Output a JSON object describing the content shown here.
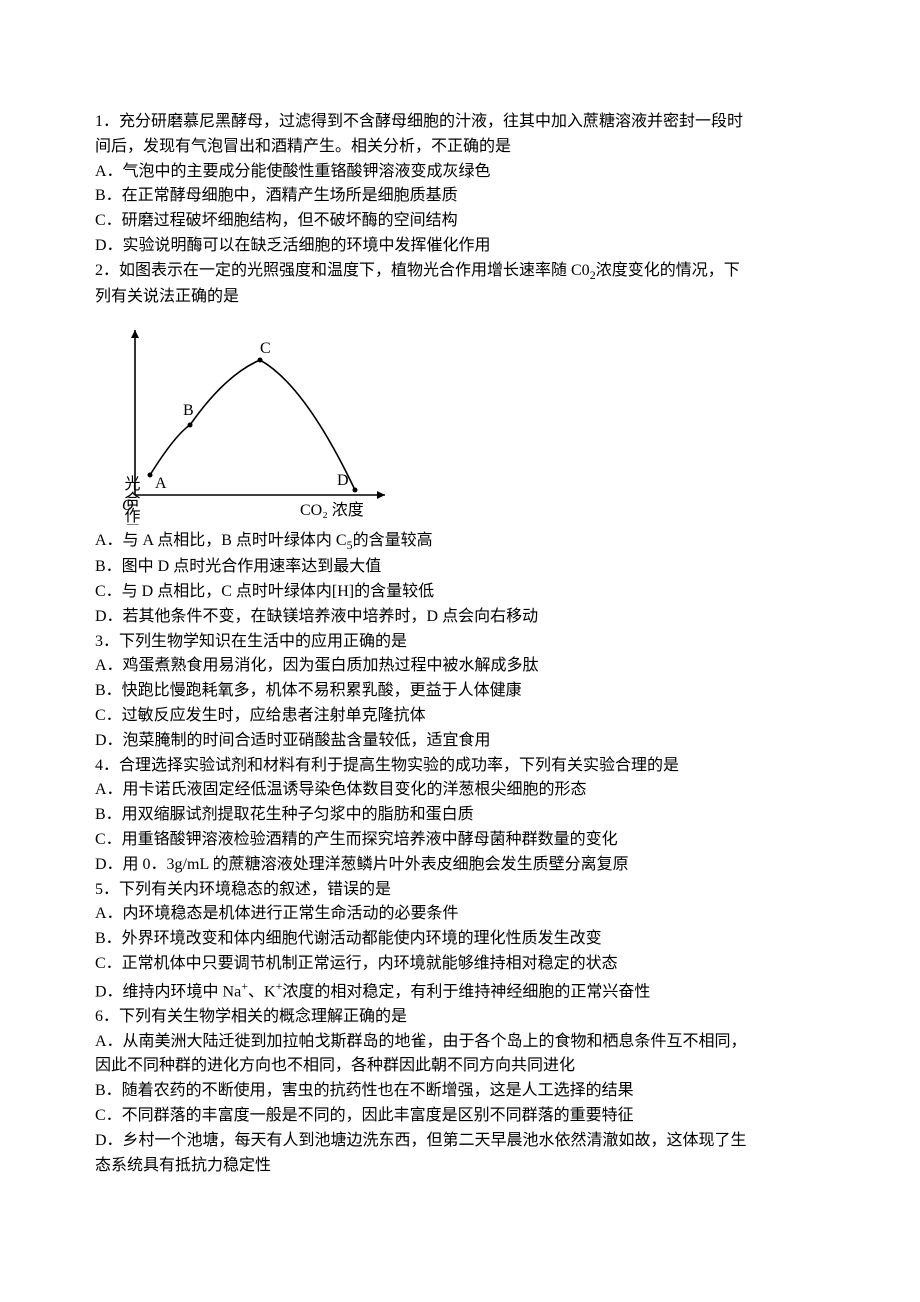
{
  "q1": {
    "stem_l1": "1．充分研磨慕尼黑酵母，过滤得到不含酵母细胞的汁液，往其中加入蔗糖溶液并密封一段时",
    "stem_l2": "间后，发现有气泡冒出和酒精产生。相关分析，不正确的是",
    "A": "A．气泡中的主要成分能使酸性重铬酸钾溶液变成灰绿色",
    "B": "B．在正常酵母细胞中，酒精产生场所是细胞质基质",
    "C": "C．研磨过程破坏细胞结构，但不破坏酶的空间结构",
    "D": "D．实验说明酶可以在缺乏活细胞的环境中发挥催化作用"
  },
  "q2": {
    "stem_l1_pre": "2．如图表示在一定的光照强度和温度下，植物光合作用增长速率随 C0",
    "stem_l1_sub": "2",
    "stem_l1_post": "浓度变化的情况，下",
    "stem_l2": "列有关说法正确的是",
    "A_pre": "A．与 A 点相比，B 点时叶绿体内 C",
    "A_sub": "5",
    "A_post": "的含量较高",
    "B": "B．图中 D 点时光合作用速率达到最大值",
    "C": "C．与 D 点相比，C 点时叶绿体内[H]的含量较低",
    "D": "D．若其他条件不变，在缺镁培养液中培养时，D 点会向右移动"
  },
  "q3": {
    "stem": "3．下列生物学知识在生活中的应用正确的是",
    "A": "A．鸡蛋煮熟食用易消化，因为蛋白质加热过程中被水解成多肽",
    "B": "B．快跑比慢跑耗氧多，机体不易积累乳酸，更益于人体健康",
    "C": "C．过敏反应发生时，应给患者注射单克隆抗体",
    "D": "D．泡菜腌制的时间合适时亚硝酸盐含量较低，适宜食用"
  },
  "q4": {
    "stem": "4．合理选择实验试剂和材料有利于提高生物实验的成功率，下列有关实验合理的是",
    "A": "A．用卡诺氏液固定经低温诱导染色体数目变化的洋葱根尖细胞的形态",
    "B": "B．用双缩脲试剂提取花生种子匀浆中的脂肪和蛋白质",
    "C": "C．用重铬酸钾溶液检验酒精的产生而探究培养液中酵母菌种群数量的变化",
    "D": "D．用 0．3g/mL 的蔗糖溶液处理洋葱鳞片叶外表皮细胞会发生质壁分离复原"
  },
  "q5": {
    "stem": "5．下列有关内环境稳态的叙述，错误的是",
    "A": "A．内环境稳态是机体进行正常生命活动的必要条件",
    "B": "B．外界环境改变和体内细胞代谢活动都能使内环境的理化性质发生改变",
    "C": "C．正常机体中只要调节机制正常运行，内环境就能够维持相对稳定的状态",
    "D_pre": "D．维持内环境中 Na",
    "D_sup1": "+",
    "D_mid": "、K",
    "D_sup2": "+",
    "D_post": "浓度的相对稳定，有利于维持神经细胞的正常兴奋性"
  },
  "q6": {
    "stem": "6．下列有关生物学相关的概念理解正确的是",
    "A_l1": "A．从南美洲大陆迁徙到加拉帕戈斯群岛的地雀，由于各个岛上的食物和栖息条件互不相同，",
    "A_l2": "因此不同种群的进化方向也不相同，各种群因此朝不同方向共同进化",
    "B": "B．随着农药的不断使用，害虫的抗药性也在不断增强，这是人工选择的结果",
    "C": "C．不同群落的丰富度一般是不同的，因此丰富度是区别不同群落的重要特征",
    "D_l1": "D．乡村一个池塘，每天有人到池塘边洗东西，但第二天早晨池水依然清澈如故，这体现了生",
    "D_l2": "态系统具有抵抗力稳定性"
  },
  "chart_data": {
    "type": "line",
    "title": "",
    "xlabel": "CO₂ 浓度",
    "ylabel": "光合作用增长速率",
    "origin_label": "O",
    "points": [
      {
        "label": "A",
        "x": 0.1,
        "y": 0.15
      },
      {
        "label": "B",
        "x": 0.22,
        "y": 0.5
      },
      {
        "label": "C",
        "x": 0.48,
        "y": 0.95
      },
      {
        "label": "D",
        "x": 0.85,
        "y": 0.05
      }
    ],
    "xlim": [
      0,
      1
    ],
    "ylim": [
      0,
      1
    ],
    "note": "curve rises from A through B to peak at C then falls to D near x-axis"
  }
}
